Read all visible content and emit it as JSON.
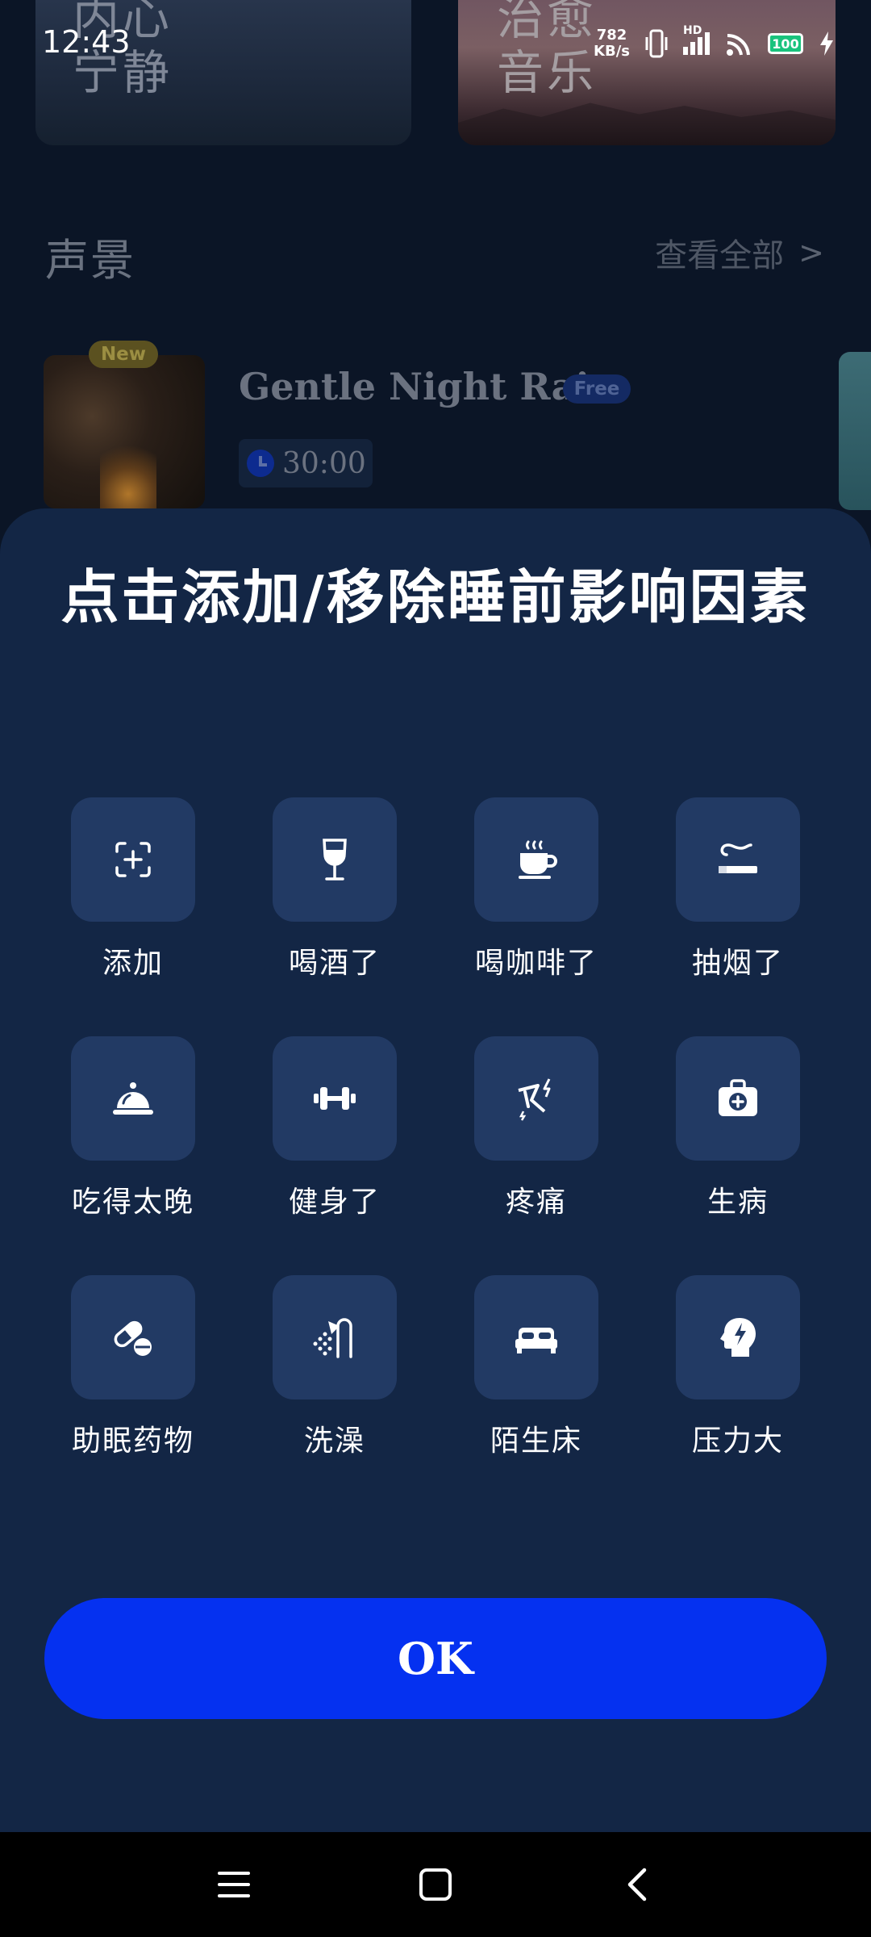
{
  "status_bar": {
    "time": "12:43",
    "net_speed_value": "782",
    "net_speed_unit": "KB/s",
    "network_label": "HD",
    "battery": "100"
  },
  "background": {
    "cards": [
      {
        "title_line1": "内心",
        "title_line2": "宁静"
      },
      {
        "title_line1": "治愈",
        "title_line2": "音乐"
      }
    ],
    "section_title": "声景",
    "see_all": "查看全部",
    "soundscape": {
      "badge_new": "New",
      "title": "Gentle Night Rain",
      "badge_free": "Free",
      "duration": "30:00"
    }
  },
  "sheet": {
    "title": "点击添加/移除睡前影响因素",
    "factors": [
      {
        "label": "添加",
        "icon": "add-scan-icon"
      },
      {
        "label": "喝酒了",
        "icon": "wine-glass-icon"
      },
      {
        "label": "喝咖啡了",
        "icon": "coffee-cup-icon"
      },
      {
        "label": "抽烟了",
        "icon": "cigarette-icon"
      },
      {
        "label": "吃得太晚",
        "icon": "food-cloche-icon"
      },
      {
        "label": "健身了",
        "icon": "dumbbell-icon"
      },
      {
        "label": "疼痛",
        "icon": "pain-bolt-icon"
      },
      {
        "label": "生病",
        "icon": "medical-kit-icon"
      },
      {
        "label": "助眠药物",
        "icon": "pills-icon"
      },
      {
        "label": "洗澡",
        "icon": "shower-icon"
      },
      {
        "label": "陌生床",
        "icon": "bed-icon"
      },
      {
        "label": "压力大",
        "icon": "stressed-head-icon"
      }
    ],
    "ok_label": "OK"
  },
  "colors": {
    "sheet_bg": "#132645",
    "tile_bg": "#223a64",
    "ok_button": "#0531f0"
  }
}
